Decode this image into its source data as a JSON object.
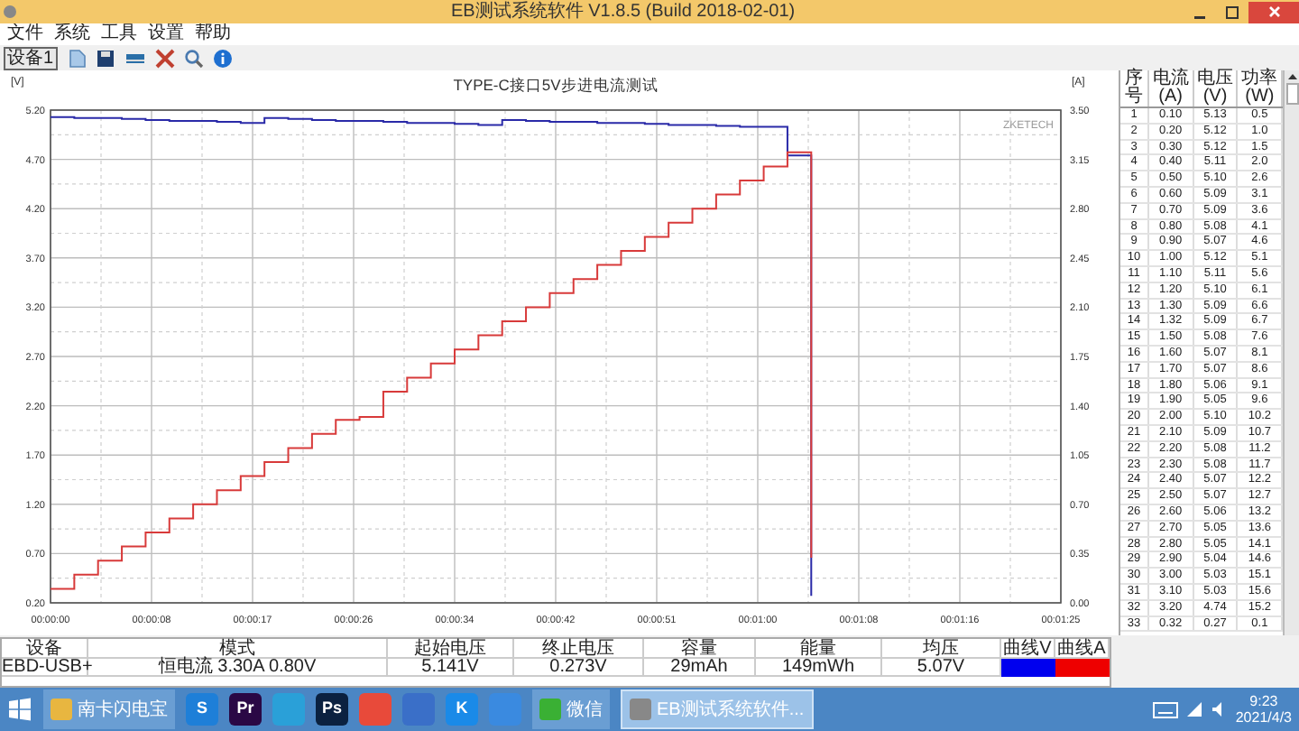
{
  "window": {
    "title": "EB测试系统软件 V1.8.5 (Build 2018-02-01)"
  },
  "menu": [
    "文件",
    "系统",
    "工具",
    "设置",
    "帮助"
  ],
  "toolbar": {
    "device_button": "设备1"
  },
  "chart": {
    "chart_data": {
      "type": "line",
      "title": "TYPE-C接口5V步进电流测试",
      "ylabel": "[V]",
      "y2label": "[A]",
      "grid": true,
      "x": [
        0,
        2,
        2,
        4,
        4,
        6,
        6,
        8,
        8,
        10,
        10,
        12,
        12,
        14,
        14,
        16,
        16,
        18,
        18,
        20,
        20,
        22,
        22,
        24,
        24,
        26,
        26,
        28,
        28,
        30,
        30,
        32,
        32,
        34,
        34,
        36,
        36,
        38,
        38,
        40,
        40,
        42,
        42,
        44,
        44,
        46,
        46,
        48,
        48,
        50,
        50,
        52,
        52,
        54,
        54,
        56,
        56,
        58,
        58,
        60,
        60,
        62,
        62,
        64,
        64
      ],
      "series": [
        {
          "color": "#2a2aa8",
          "values": [
            5.13,
            5.13,
            5.12,
            5.12,
            5.12,
            5.12,
            5.11,
            5.11,
            5.1,
            5.1,
            5.09,
            5.09,
            5.09,
            5.09,
            5.08,
            5.08,
            5.07,
            5.07,
            5.12,
            5.12,
            5.11,
            5.11,
            5.1,
            5.1,
            5.09,
            5.09,
            5.09,
            5.09,
            5.08,
            5.08,
            5.07,
            5.07,
            5.07,
            5.07,
            5.06,
            5.06,
            5.05,
            5.05,
            5.1,
            5.1,
            5.09,
            5.09,
            5.08,
            5.08,
            5.08,
            5.08,
            5.07,
            5.07,
            5.07,
            5.07,
            5.06,
            5.06,
            5.05,
            5.05,
            5.05,
            5.05,
            5.04,
            5.04,
            5.03,
            5.03,
            5.03,
            5.03,
            4.74,
            4.74,
            0.27
          ]
        },
        {
          "axis": "y2",
          "color": "#d83a3a",
          "values": [
            0.1,
            0.1,
            0.2,
            0.2,
            0.3,
            0.3,
            0.4,
            0.4,
            0.5,
            0.5,
            0.6,
            0.6,
            0.7,
            0.7,
            0.8,
            0.8,
            0.9,
            0.9,
            1.0,
            1.0,
            1.1,
            1.1,
            1.2,
            1.2,
            1.3,
            1.3,
            1.32,
            1.32,
            1.5,
            1.5,
            1.6,
            1.6,
            1.7,
            1.7,
            1.8,
            1.8,
            1.9,
            1.9,
            2.0,
            2.0,
            2.1,
            2.1,
            2.2,
            2.2,
            2.3,
            2.3,
            2.4,
            2.4,
            2.5,
            2.5,
            2.6,
            2.6,
            2.7,
            2.7,
            2.8,
            2.8,
            2.9,
            2.9,
            3.0,
            3.0,
            3.1,
            3.1,
            3.2,
            3.2,
            0.32
          ]
        }
      ],
      "xlim": [
        0,
        85
      ],
      "ylim": [
        0.2,
        5.2
      ],
      "y2lim": [
        0,
        3.5
      ],
      "xticks": [
        {
          "value": 0,
          "label": "00:00:00"
        },
        {
          "value": 8.5,
          "label": "00:00:08"
        },
        {
          "value": 17,
          "label": "00:00:17"
        },
        {
          "value": 25.5,
          "label": "00:00:26"
        },
        {
          "value": 34,
          "label": "00:00:34"
        },
        {
          "value": 42.5,
          "label": "00:00:42"
        },
        {
          "value": 51,
          "label": "00:00:51"
        },
        {
          "value": 59.5,
          "label": "00:01:00"
        },
        {
          "value": 68,
          "label": "00:01:08"
        },
        {
          "value": 76.5,
          "label": "00:01:16"
        },
        {
          "value": 85,
          "label": "00:01:25"
        }
      ],
      "yticks": [
        {
          "value": 0.2,
          "label": "0.20"
        },
        {
          "value": 0.7,
          "label": "0.70"
        },
        {
          "value": 1.2,
          "label": "1.20"
        },
        {
          "value": 1.7,
          "label": "1.70"
        },
        {
          "value": 2.2,
          "label": "2.20"
        },
        {
          "value": 2.7,
          "label": "2.70"
        },
        {
          "value": 3.2,
          "label": "3.20"
        },
        {
          "value": 3.7,
          "label": "3.70"
        },
        {
          "value": 4.2,
          "label": "4.20"
        },
        {
          "value": 4.7,
          "label": "4.70"
        },
        {
          "value": 5.2,
          "label": "5.20"
        }
      ],
      "y2ticks": [
        {
          "value": 0,
          "label": "0.00"
        },
        {
          "value": 0.35,
          "label": "0.35"
        },
        {
          "value": 0.7,
          "label": "0.70"
        },
        {
          "value": 1.05,
          "label": "1.05"
        },
        {
          "value": 1.4,
          "label": "1.40"
        },
        {
          "value": 1.75,
          "label": "1.75"
        },
        {
          "value": 2.1,
          "label": "2.10"
        },
        {
          "value": 2.45,
          "label": "2.45"
        },
        {
          "value": 2.8,
          "label": "2.80"
        },
        {
          "value": 3.15,
          "label": "3.15"
        },
        {
          "value": 3.5,
          "label": "3.50"
        }
      ],
      "annotations": [
        "ZKETECH"
      ]
    }
  },
  "readings": {
    "columns": [
      "序号",
      "电流(A)",
      "电压(V)",
      "功率(W)"
    ],
    "rows": [
      [
        "1",
        "0.10",
        "5.13",
        "0.5"
      ],
      [
        "2",
        "0.20",
        "5.12",
        "1.0"
      ],
      [
        "3",
        "0.30",
        "5.12",
        "1.5"
      ],
      [
        "4",
        "0.40",
        "5.11",
        "2.0"
      ],
      [
        "5",
        "0.50",
        "5.10",
        "2.6"
      ],
      [
        "6",
        "0.60",
        "5.09",
        "3.1"
      ],
      [
        "7",
        "0.70",
        "5.09",
        "3.6"
      ],
      [
        "8",
        "0.80",
        "5.08",
        "4.1"
      ],
      [
        "9",
        "0.90",
        "5.07",
        "4.6"
      ],
      [
        "10",
        "1.00",
        "5.12",
        "5.1"
      ],
      [
        "11",
        "1.10",
        "5.11",
        "5.6"
      ],
      [
        "12",
        "1.20",
        "5.10",
        "6.1"
      ],
      [
        "13",
        "1.30",
        "5.09",
        "6.6"
      ],
      [
        "14",
        "1.32",
        "5.09",
        "6.7"
      ],
      [
        "15",
        "1.50",
        "5.08",
        "7.6"
      ],
      [
        "16",
        "1.60",
        "5.07",
        "8.1"
      ],
      [
        "17",
        "1.70",
        "5.07",
        "8.6"
      ],
      [
        "18",
        "1.80",
        "5.06",
        "9.1"
      ],
      [
        "19",
        "1.90",
        "5.05",
        "9.6"
      ],
      [
        "20",
        "2.00",
        "5.10",
        "10.2"
      ],
      [
        "21",
        "2.10",
        "5.09",
        "10.7"
      ],
      [
        "22",
        "2.20",
        "5.08",
        "11.2"
      ],
      [
        "23",
        "2.30",
        "5.08",
        "11.7"
      ],
      [
        "24",
        "2.40",
        "5.07",
        "12.2"
      ],
      [
        "25",
        "2.50",
        "5.07",
        "12.7"
      ],
      [
        "26",
        "2.60",
        "5.06",
        "13.2"
      ],
      [
        "27",
        "2.70",
        "5.05",
        "13.6"
      ],
      [
        "28",
        "2.80",
        "5.05",
        "14.1"
      ],
      [
        "29",
        "2.90",
        "5.04",
        "14.6"
      ],
      [
        "30",
        "3.00",
        "5.03",
        "15.1"
      ],
      [
        "31",
        "3.10",
        "5.03",
        "15.6"
      ],
      [
        "32",
        "3.20",
        "4.74",
        "15.2"
      ],
      [
        "33",
        "0.32",
        "0.27",
        "0.1"
      ]
    ]
  },
  "summary": {
    "columns": [
      "设备",
      "模式",
      "起始电压",
      "终止电压",
      "容量",
      "能量",
      "均压",
      "曲线V",
      "曲线A"
    ],
    "rows": [
      {
        "cells": [
          "EBD-USB+",
          "恒电流  3.30A  0.80V",
          "5.141V",
          "0.273V",
          "29mAh",
          "149mWh",
          "5.07V"
        ],
        "curves": [
          {
            "color": "#0000ee"
          },
          {
            "color": "#ee0000"
          }
        ]
      }
    ]
  },
  "taskbar": {
    "items": [
      {
        "kind": "window",
        "label": "南卡闪电宝",
        "color": "#e8b640",
        "selected": false
      },
      {
        "kind": "app",
        "glyph": "S",
        "color": "#1e7fd8"
      },
      {
        "kind": "app",
        "glyph": "Pr",
        "color": "#2a0845"
      },
      {
        "kind": "app",
        "color": "#2aa0d8"
      },
      {
        "kind": "app",
        "glyph": "Ps",
        "color": "#0b2140"
      },
      {
        "kind": "app",
        "color": "#e84a3a"
      },
      {
        "kind": "app",
        "color": "#3a6fc8"
      },
      {
        "kind": "app",
        "glyph": "K",
        "color": "#1a8ae8"
      },
      {
        "kind": "app",
        "color": "#3a8ae0"
      },
      {
        "kind": "window",
        "label": "微信",
        "color": "#3ab034",
        "selected": false
      },
      {
        "kind": "window",
        "label": "EB测试系统软件...",
        "color": "#888888",
        "selected": true
      }
    ],
    "clock": {
      "time": "9:23",
      "date": "2021/4/3"
    }
  }
}
